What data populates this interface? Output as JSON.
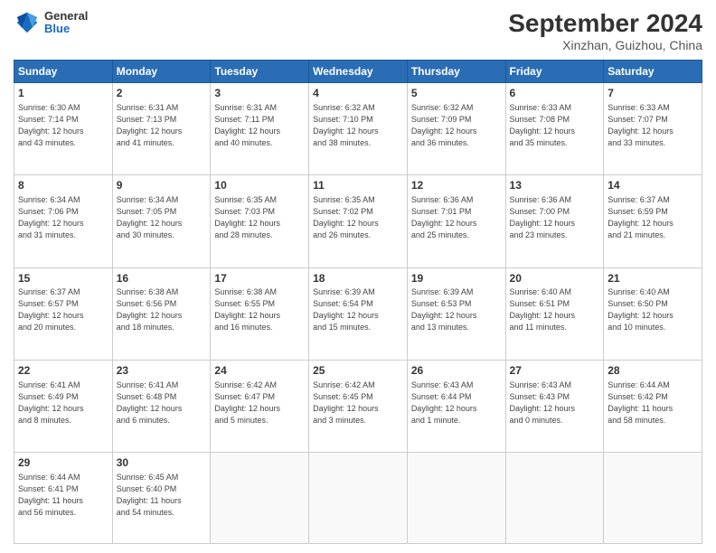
{
  "logo": {
    "general": "General",
    "blue": "Blue"
  },
  "header": {
    "month": "September 2024",
    "location": "Xinzhan, Guizhou, China"
  },
  "weekdays": [
    "Sunday",
    "Monday",
    "Tuesday",
    "Wednesday",
    "Thursday",
    "Friday",
    "Saturday"
  ],
  "weeks": [
    [
      {
        "day": "1",
        "info": "Sunrise: 6:30 AM\nSunset: 7:14 PM\nDaylight: 12 hours\nand 43 minutes."
      },
      {
        "day": "2",
        "info": "Sunrise: 6:31 AM\nSunset: 7:13 PM\nDaylight: 12 hours\nand 41 minutes."
      },
      {
        "day": "3",
        "info": "Sunrise: 6:31 AM\nSunset: 7:11 PM\nDaylight: 12 hours\nand 40 minutes."
      },
      {
        "day": "4",
        "info": "Sunrise: 6:32 AM\nSunset: 7:10 PM\nDaylight: 12 hours\nand 38 minutes."
      },
      {
        "day": "5",
        "info": "Sunrise: 6:32 AM\nSunset: 7:09 PM\nDaylight: 12 hours\nand 36 minutes."
      },
      {
        "day": "6",
        "info": "Sunrise: 6:33 AM\nSunset: 7:08 PM\nDaylight: 12 hours\nand 35 minutes."
      },
      {
        "day": "7",
        "info": "Sunrise: 6:33 AM\nSunset: 7:07 PM\nDaylight: 12 hours\nand 33 minutes."
      }
    ],
    [
      {
        "day": "8",
        "info": "Sunrise: 6:34 AM\nSunset: 7:06 PM\nDaylight: 12 hours\nand 31 minutes."
      },
      {
        "day": "9",
        "info": "Sunrise: 6:34 AM\nSunset: 7:05 PM\nDaylight: 12 hours\nand 30 minutes."
      },
      {
        "day": "10",
        "info": "Sunrise: 6:35 AM\nSunset: 7:03 PM\nDaylight: 12 hours\nand 28 minutes."
      },
      {
        "day": "11",
        "info": "Sunrise: 6:35 AM\nSunset: 7:02 PM\nDaylight: 12 hours\nand 26 minutes."
      },
      {
        "day": "12",
        "info": "Sunrise: 6:36 AM\nSunset: 7:01 PM\nDaylight: 12 hours\nand 25 minutes."
      },
      {
        "day": "13",
        "info": "Sunrise: 6:36 AM\nSunset: 7:00 PM\nDaylight: 12 hours\nand 23 minutes."
      },
      {
        "day": "14",
        "info": "Sunrise: 6:37 AM\nSunset: 6:59 PM\nDaylight: 12 hours\nand 21 minutes."
      }
    ],
    [
      {
        "day": "15",
        "info": "Sunrise: 6:37 AM\nSunset: 6:57 PM\nDaylight: 12 hours\nand 20 minutes."
      },
      {
        "day": "16",
        "info": "Sunrise: 6:38 AM\nSunset: 6:56 PM\nDaylight: 12 hours\nand 18 minutes."
      },
      {
        "day": "17",
        "info": "Sunrise: 6:38 AM\nSunset: 6:55 PM\nDaylight: 12 hours\nand 16 minutes."
      },
      {
        "day": "18",
        "info": "Sunrise: 6:39 AM\nSunset: 6:54 PM\nDaylight: 12 hours\nand 15 minutes."
      },
      {
        "day": "19",
        "info": "Sunrise: 6:39 AM\nSunset: 6:53 PM\nDaylight: 12 hours\nand 13 minutes."
      },
      {
        "day": "20",
        "info": "Sunrise: 6:40 AM\nSunset: 6:51 PM\nDaylight: 12 hours\nand 11 minutes."
      },
      {
        "day": "21",
        "info": "Sunrise: 6:40 AM\nSunset: 6:50 PM\nDaylight: 12 hours\nand 10 minutes."
      }
    ],
    [
      {
        "day": "22",
        "info": "Sunrise: 6:41 AM\nSunset: 6:49 PM\nDaylight: 12 hours\nand 8 minutes."
      },
      {
        "day": "23",
        "info": "Sunrise: 6:41 AM\nSunset: 6:48 PM\nDaylight: 12 hours\nand 6 minutes."
      },
      {
        "day": "24",
        "info": "Sunrise: 6:42 AM\nSunset: 6:47 PM\nDaylight: 12 hours\nand 5 minutes."
      },
      {
        "day": "25",
        "info": "Sunrise: 6:42 AM\nSunset: 6:45 PM\nDaylight: 12 hours\nand 3 minutes."
      },
      {
        "day": "26",
        "info": "Sunrise: 6:43 AM\nSunset: 6:44 PM\nDaylight: 12 hours\nand 1 minute."
      },
      {
        "day": "27",
        "info": "Sunrise: 6:43 AM\nSunset: 6:43 PM\nDaylight: 12 hours\nand 0 minutes."
      },
      {
        "day": "28",
        "info": "Sunrise: 6:44 AM\nSunset: 6:42 PM\nDaylight: 11 hours\nand 58 minutes."
      }
    ],
    [
      {
        "day": "29",
        "info": "Sunrise: 6:44 AM\nSunset: 6:41 PM\nDaylight: 11 hours\nand 56 minutes."
      },
      {
        "day": "30",
        "info": "Sunrise: 6:45 AM\nSunset: 6:40 PM\nDaylight: 11 hours\nand 54 minutes."
      },
      {
        "day": "",
        "info": ""
      },
      {
        "day": "",
        "info": ""
      },
      {
        "day": "",
        "info": ""
      },
      {
        "day": "",
        "info": ""
      },
      {
        "day": "",
        "info": ""
      }
    ]
  ]
}
